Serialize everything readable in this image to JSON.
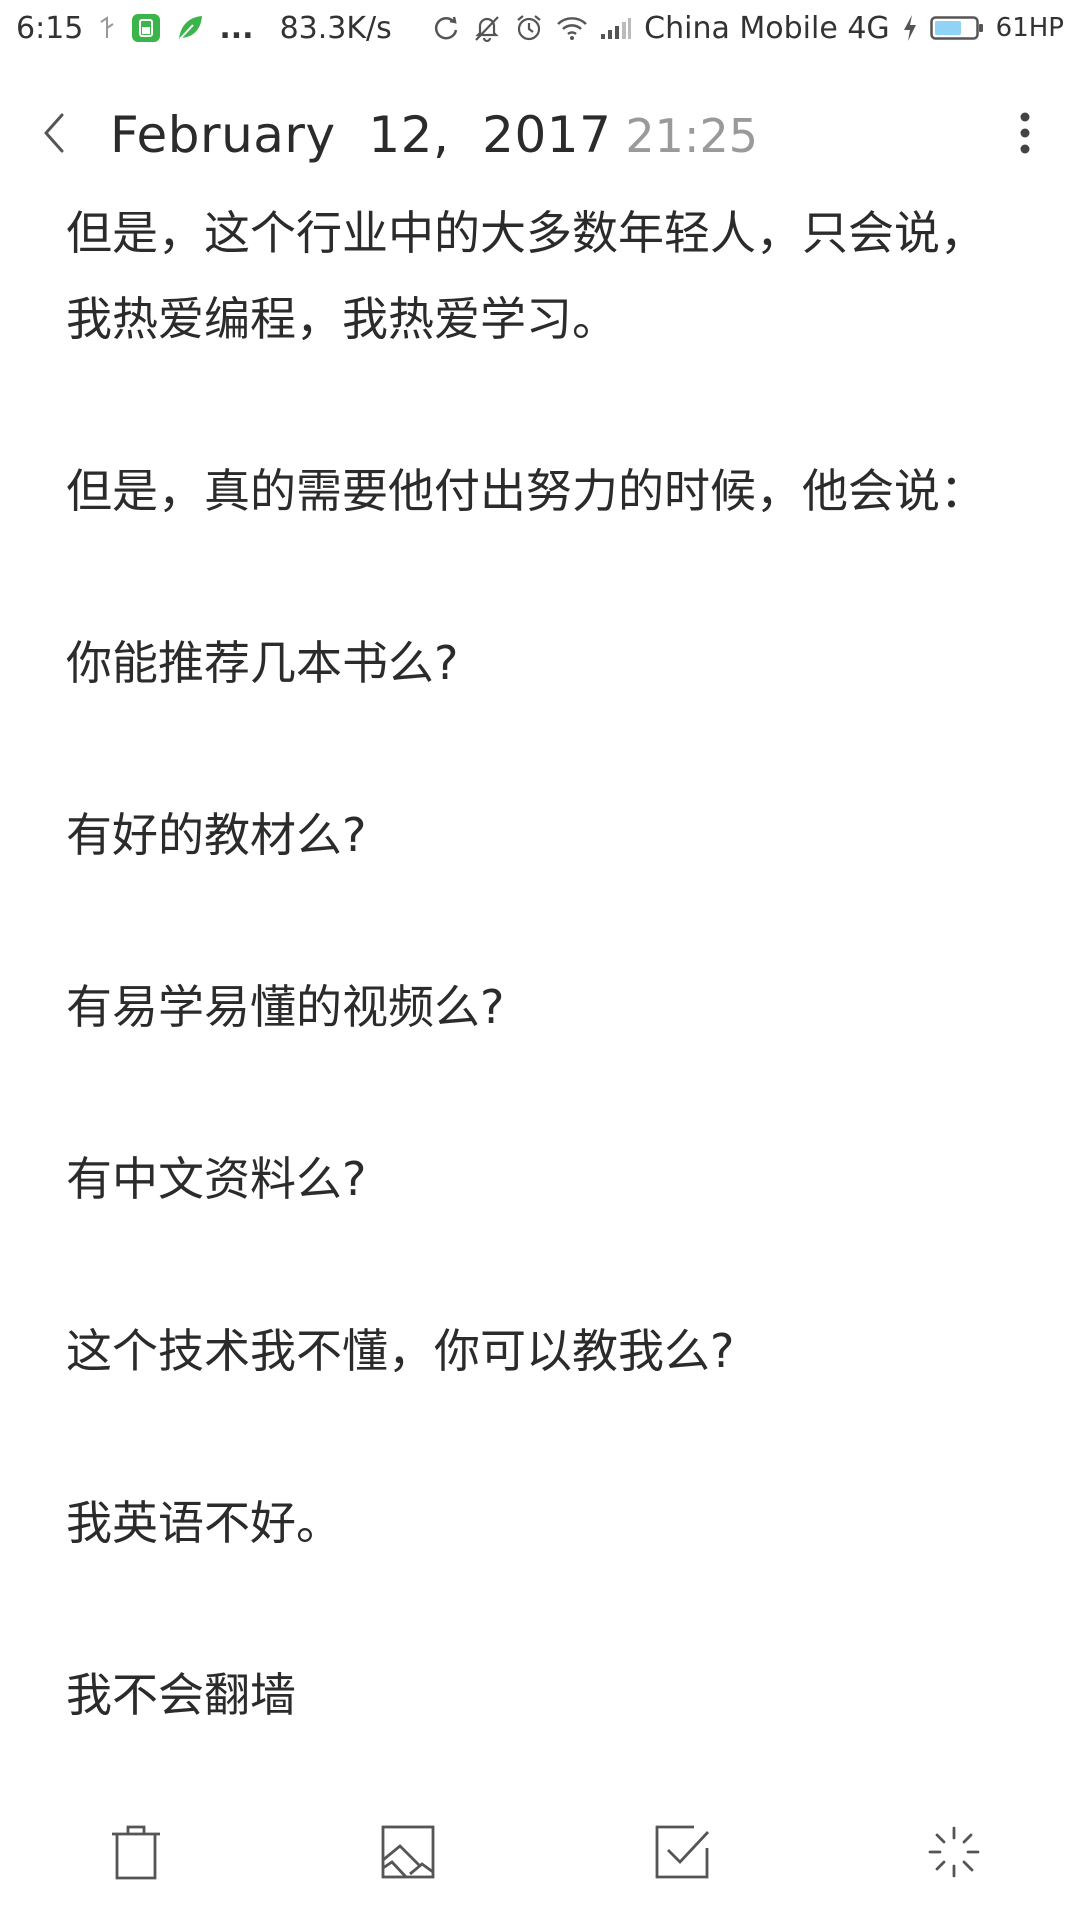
{
  "status_bar": {
    "time": "6:15",
    "dots": "...",
    "speed": "83.3K/s",
    "carrier": "China Mobile 4G",
    "battery": "61HP"
  },
  "header": {
    "date": "February  12,  2017",
    "time": "21:25"
  },
  "note": {
    "paragraphs": [
      "但是，这个行业中的大多数年轻人，只会说，我热爱编程，我热爱学习。",
      "但是，真的需要他付出努力的时候，他会说：",
      "你能推荐几本书么?",
      "有好的教材么?",
      "有易学易懂的视频么?",
      "有中文资料么?",
      "这个技术我不懂，你可以教我么?",
      "我英语不好。",
      "我不会翻墙"
    ]
  },
  "toolbar": {
    "icons": [
      "delete-icon",
      "image-icon",
      "checklist-icon",
      "magic-icon"
    ]
  },
  "colors": {
    "text": "#2b2b2b",
    "muted": "#9a9a9a",
    "icon": "#555555",
    "battery_fill": "#8fd3f5",
    "status_green": "#3bb54a"
  }
}
